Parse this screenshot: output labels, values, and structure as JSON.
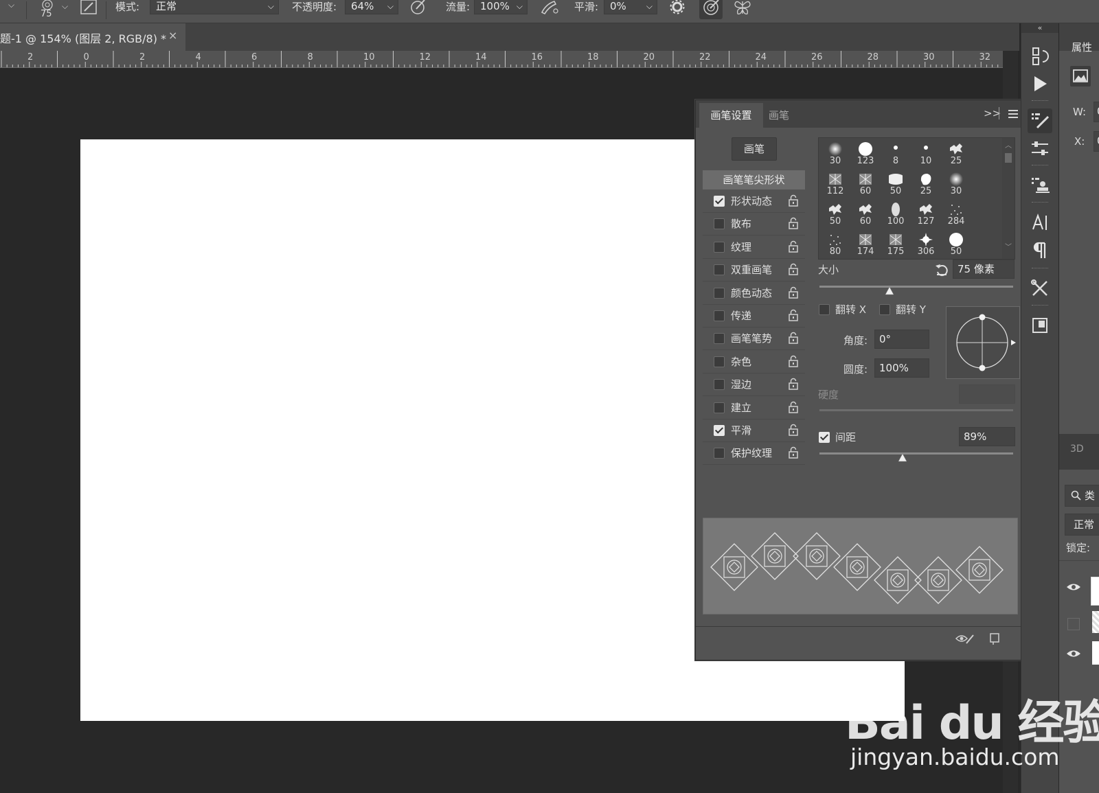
{
  "options_bar": {
    "brush_size": "75",
    "mode_label": "模式:",
    "mode_value": "正常",
    "opacity_label": "不透明度:",
    "opacity_value": "64%",
    "flow_label": "流量:",
    "flow_value": "100%",
    "smoothing_label": "平滑:",
    "smoothing_value": "0%"
  },
  "document": {
    "tab_title": "题-1 @ 154% (图层 2, RGB/8) *",
    "close_glyph": "×"
  },
  "ruler": {
    "labels": [
      "2",
      "0",
      "2",
      "4",
      "6",
      "8",
      "10",
      "12",
      "14",
      "16",
      "18",
      "20",
      "22",
      "24",
      "26",
      "28",
      "30",
      "32"
    ]
  },
  "brush_panel": {
    "tabs": [
      "画笔设置",
      "画笔"
    ],
    "expand_glyph": ">>",
    "brush_button": "画笔",
    "tip_shape_header": "画笔笔尖形状",
    "options": [
      {
        "label": "形状动态",
        "checked": true
      },
      {
        "label": "散布",
        "checked": false
      },
      {
        "label": "纹理",
        "checked": false
      },
      {
        "label": "双重画笔",
        "checked": false
      },
      {
        "label": "颜色动态",
        "checked": false
      },
      {
        "label": "传递",
        "checked": false
      },
      {
        "label": "画笔笔势",
        "checked": false
      },
      {
        "label": "杂色",
        "checked": false
      },
      {
        "label": "湿边",
        "checked": false
      },
      {
        "label": "建立",
        "checked": false
      },
      {
        "label": "平滑",
        "checked": true
      },
      {
        "label": "保护纹理",
        "checked": false
      }
    ],
    "presets": [
      "30",
      "123",
      "8",
      "10",
      "25",
      "112",
      "60",
      "50",
      "25",
      "30",
      "50",
      "60",
      "100",
      "127",
      "284",
      "80",
      "174",
      "175",
      "306",
      "50"
    ],
    "size_label": "大小",
    "size_value": "75 像素",
    "size_slider": 0.36,
    "flip_x_label": "翻转 X",
    "flip_y_label": "翻转 Y",
    "angle_label": "角度:",
    "angle_value": "0°",
    "roundness_label": "圆度:",
    "roundness_value": "100%",
    "hardness_label": "硬度",
    "spacing_label": "间距",
    "spacing_checked": true,
    "spacing_value": "89%",
    "spacing_slider": 0.43
  },
  "properties_panel": {
    "title": "属性",
    "w_label": "W:",
    "w_value": "0",
    "x_label": "X:",
    "x_value": "0",
    "tab_3d": "3D",
    "search_text": "类",
    "blend_mode": "正常",
    "lock_label": "锁定:"
  },
  "watermark": {
    "logo_text": "Bai du 经验",
    "url": "jingyan.baidu.com"
  },
  "colors": {
    "workspace": "#282828",
    "panel": "#535353",
    "panel_dark": "#424242",
    "canvas": "#ffffff"
  }
}
